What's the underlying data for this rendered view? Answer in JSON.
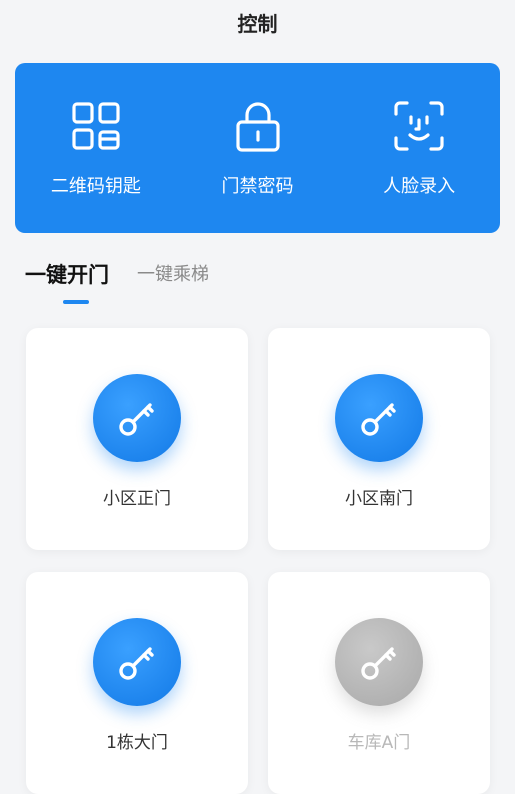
{
  "header": {
    "title": "控制"
  },
  "controls": [
    {
      "label": "二维码钥匙",
      "icon": "qr-code-icon"
    },
    {
      "label": "门禁密码",
      "icon": "lock-icon"
    },
    {
      "label": "人脸录入",
      "icon": "face-scan-icon"
    }
  ],
  "tabs": [
    {
      "label": "一键开门",
      "active": true
    },
    {
      "label": "一键乘梯",
      "active": false
    }
  ],
  "doors": [
    {
      "label": "小区正门",
      "enabled": true,
      "icon": "key-icon"
    },
    {
      "label": "小区南门",
      "enabled": true,
      "icon": "key-icon"
    },
    {
      "label": "1栋大门",
      "enabled": true,
      "icon": "key-icon"
    },
    {
      "label": "车库A门",
      "enabled": false,
      "icon": "key-icon"
    }
  ],
  "colors": {
    "accent": "#1e87f0",
    "disabled": "#a8a8a8",
    "background": "#f4f5f7"
  }
}
